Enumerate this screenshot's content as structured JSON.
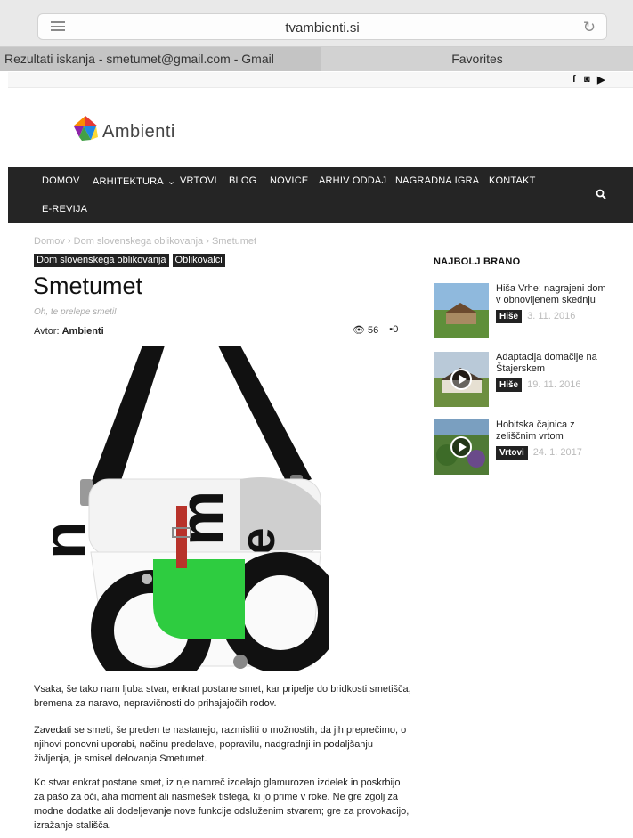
{
  "browser": {
    "url": "tvambienti.si",
    "tabs": [
      "Rezultati iskanja - smetumet@gmail.com - Gmail",
      "Favorites"
    ]
  },
  "social": {
    "facebook": "f",
    "instagram": "◙",
    "youtube": "▶"
  },
  "site": {
    "logo_text": "Ambienti"
  },
  "nav": {
    "items": [
      "DOMOV",
      "ARHITEKTURA",
      "VRTOVI",
      "BLOG",
      "NOVICE",
      "ARHIV ODDAJ",
      "NAGRADNA IGRA",
      "KONTAKT",
      "E-REVIJA"
    ]
  },
  "breadcrumb": {
    "home": "Domov",
    "sep1": "›",
    "section": "Dom slovenskega oblikovanja",
    "sep2": "›",
    "current": "Smetumet"
  },
  "article": {
    "categories": [
      "Dom slovenskega oblikovanja",
      "Oblikovalci"
    ],
    "title": "Smetumet",
    "subtitle": "Oh, te prelepe smeti!",
    "author_label": "Avtor:",
    "author": "Ambienti",
    "views": "56",
    "comments": "0",
    "paragraphs": [
      "Vsaka, še tako nam ljuba stvar, enkrat postane smet, kar pripelje do bridkosti smetišča, bremena za naravo, nepravičnosti do prihajajočih rodov.",
      "Zavedati se smeti, še preden te nastanejo, razmisliti o možnostih, da jih preprečimo, o njihovi ponovni uporabi, načinu predelave, popravilu, nadgradnji in podaljšanju življenja, je smisel delovanja Smetumet.",
      "Ko stvar enkrat postane smet, iz nje namreč izdelajo glamurozen izdelek in poskrbijo za pašo za oči, aha moment ali nasmešek tistega, ki jo prime v roke. Ne gre zgolj za modne dodatke ali dodeljevanje nove funkcije odsluženim stvarem; gre za provokacijo, izražanje stališča."
    ]
  },
  "sidebar": {
    "title": "NAJBOLJ BRANO",
    "items": [
      {
        "title": "Hiša Vrhe: nagrajeni dom v obnovljenem skednju",
        "category": "Hiše",
        "date": "3. 11. 2016"
      },
      {
        "title": "Adaptacija domačije na Štajerskem",
        "category": "Hiše",
        "date": "19. 11. 2016"
      },
      {
        "title": "Hobitska čajnica z zeliščnim vrtom",
        "category": "Vrtovi",
        "date": "24. 1. 2017"
      }
    ]
  }
}
